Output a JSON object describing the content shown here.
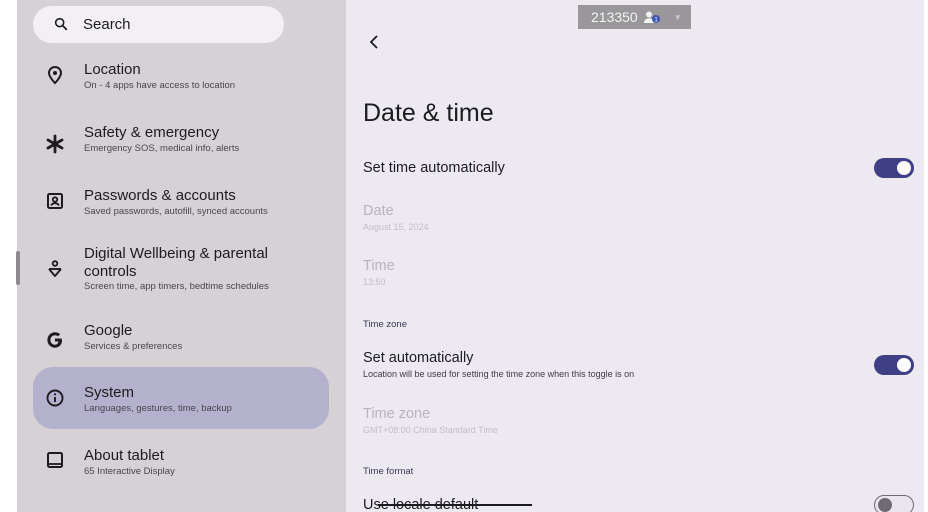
{
  "search": {
    "label": "Search"
  },
  "nav_items": [
    {
      "title": "Location",
      "subtitle": "On - 4 apps have access to location",
      "icon": "location-pin-icon"
    },
    {
      "title": "Safety & emergency",
      "subtitle": "Emergency SOS, medical info, alerts",
      "icon": "asterisk-icon"
    },
    {
      "title": "Passwords & accounts",
      "subtitle": "Saved passwords, autofill, synced accounts",
      "icon": "account-box-icon"
    },
    {
      "title": "Digital Wellbeing & parental",
      "title2": "controls",
      "subtitle": "Screen time, app timers, bedtime schedules",
      "icon": "wellbeing-icon"
    },
    {
      "title": "Google",
      "subtitle": "Services & preferences",
      "icon": "google-g-icon"
    },
    {
      "title": "System",
      "subtitle": "Languages, gestures, time, backup",
      "icon": "info-icon",
      "active": true
    },
    {
      "title": "About tablet",
      "subtitle": "65 Interactive Display",
      "icon": "tablet-icon"
    }
  ],
  "detail": {
    "title": "Date & time",
    "set_time_auto": {
      "title": "Set time automatically",
      "enabled": true
    },
    "date": {
      "title": "Date",
      "value": "August 15, 2024"
    },
    "time": {
      "title": "Time",
      "value": "13:50"
    },
    "time_zone_section": "Time zone",
    "set_tz_auto": {
      "title": "Set automatically",
      "subtitle": "Location will be used for setting the time zone when this toggle is on",
      "enabled": true
    },
    "time_zone": {
      "title": "Time zone",
      "value": "GMT+08:00 China Standard Time"
    },
    "time_format_section": "Time format",
    "locale_default": {
      "title": "Use locale default",
      "enabled": false
    }
  },
  "overlay": {
    "id": "213350",
    "user_count": "1"
  },
  "colors": {
    "accent": "#3f3f86",
    "active_bg": "#b4b1cc",
    "left_bg": "#d6d1d5",
    "right_bg": "#ece9f0"
  }
}
